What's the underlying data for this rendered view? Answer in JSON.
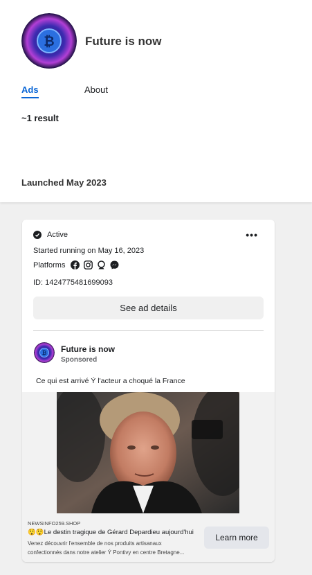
{
  "page": {
    "name": "Future is now",
    "tabs": [
      {
        "label": "Ads",
        "active": true
      },
      {
        "label": "About",
        "active": false
      }
    ],
    "result_count": "~1 result",
    "launched": "Launched May 2023"
  },
  "ad_card": {
    "status": "Active",
    "started": "Started running on May 16, 2023",
    "platforms_label": "Platforms",
    "platform_icons": [
      "facebook-icon",
      "instagram-icon",
      "audience-network-icon",
      "messenger-icon"
    ],
    "id_text": "ID: 1424775481699093",
    "details_button": "See ad details",
    "advertiser": "Future is now",
    "sponsored": "Sponsored",
    "body_text": "Ce qui est arrivé Ý l'acteur a choqué la France",
    "link": {
      "domain": "NEWSINFO259.SHOP",
      "headline": "😲😲Le destin tragique de Gérard Depardieu aujourd'hui",
      "description_line1": "Venez découvrir l'ensemble de nos produits artisanaux",
      "description_line2": "confectionnés dans notre atelier Ý Pontivy en centre Bretagne...",
      "cta": "Learn more"
    }
  },
  "colors": {
    "accent": "#0a66d6",
    "background": "#f0f0f0",
    "card": "#ffffff"
  }
}
